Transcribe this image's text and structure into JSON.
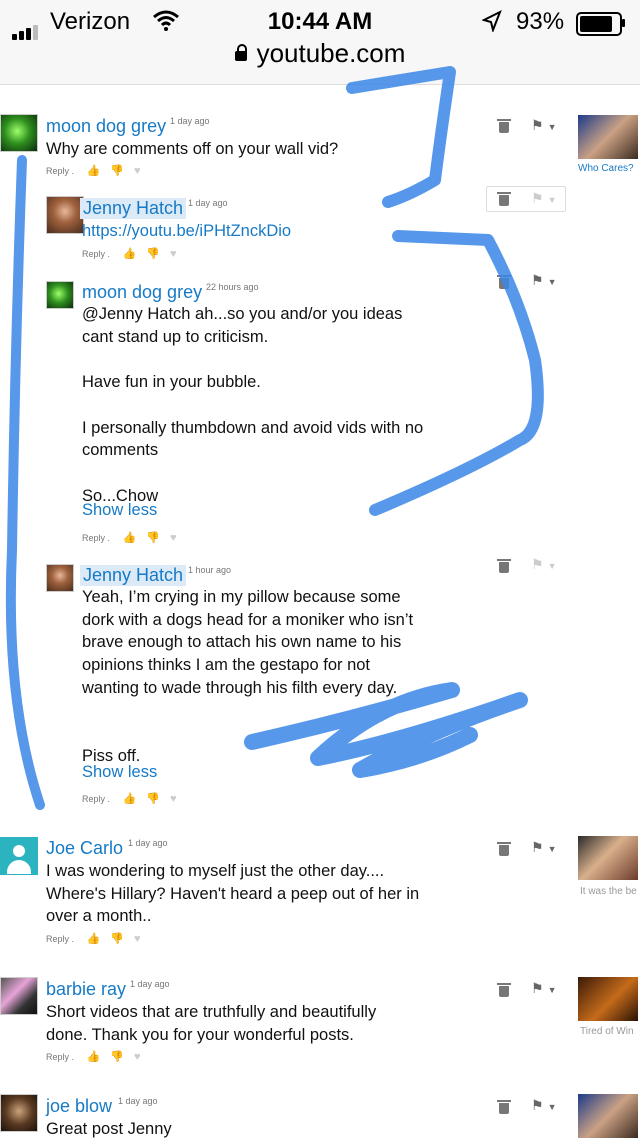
{
  "status": {
    "carrier": "Verizon",
    "time": "10:44 AM",
    "battery": "93%",
    "battery_level": 0.93
  },
  "url": "youtube.com",
  "comments": [
    {
      "user": "moon dog grey",
      "time": "1 day ago",
      "text": "Why are comments off on your wall vid?",
      "reply": "Reply"
    },
    {
      "user": "Jenny Hatch",
      "time": "1 day ago",
      "text": "https://youtu.be/iPHtZnckDio",
      "reply": "Reply"
    },
    {
      "user": "moon dog grey",
      "time": "22 hours ago",
      "text": "@Jenny Hatch ah...so you and/or you ideas\ncant stand up to criticism.\n\nHave fun in your bubble.\n\nI personally thumbdown and avoid vids with no\ncomments\n\nSo...Chow",
      "show_less": "Show less",
      "reply": "Reply"
    },
    {
      "user": "Jenny Hatch",
      "time": "1 hour ago",
      "text": "Yeah, I’m crying in my pillow because some\ndork with a dogs head for a moniker who isn’t\nbrave enough to attach his own name to his\nopinions thinks I am the gestapo for not\nwanting to wade through his filth every day.\n\n\nPiss off.",
      "show_less": "Show less",
      "reply": "Reply"
    },
    {
      "user": "Joe Carlo",
      "time": "1 day ago",
      "text": "I was wondering to myself just the other day....\nWhere's Hillary? Haven't heard a peep out of her in\nover a month..",
      "reply": "Reply"
    },
    {
      "user": "barbie ray",
      "time": "1 day ago",
      "text": "Short videos that are truthfully and beautifully\ndone. Thank you for your wonderful posts.",
      "reply": "Reply"
    },
    {
      "user": "joe blow",
      "time": "1 day ago",
      "text": "Great post Jenny",
      "reply": "Reply"
    }
  ],
  "side_videos": [
    {
      "caption": "Who Cares?"
    },
    {
      "caption": "It was the be"
    },
    {
      "caption": "Tired of Win"
    },
    {
      "caption": ""
    }
  ],
  "colors": {
    "link": "#167ac6",
    "scribble": "#3a86e8"
  }
}
